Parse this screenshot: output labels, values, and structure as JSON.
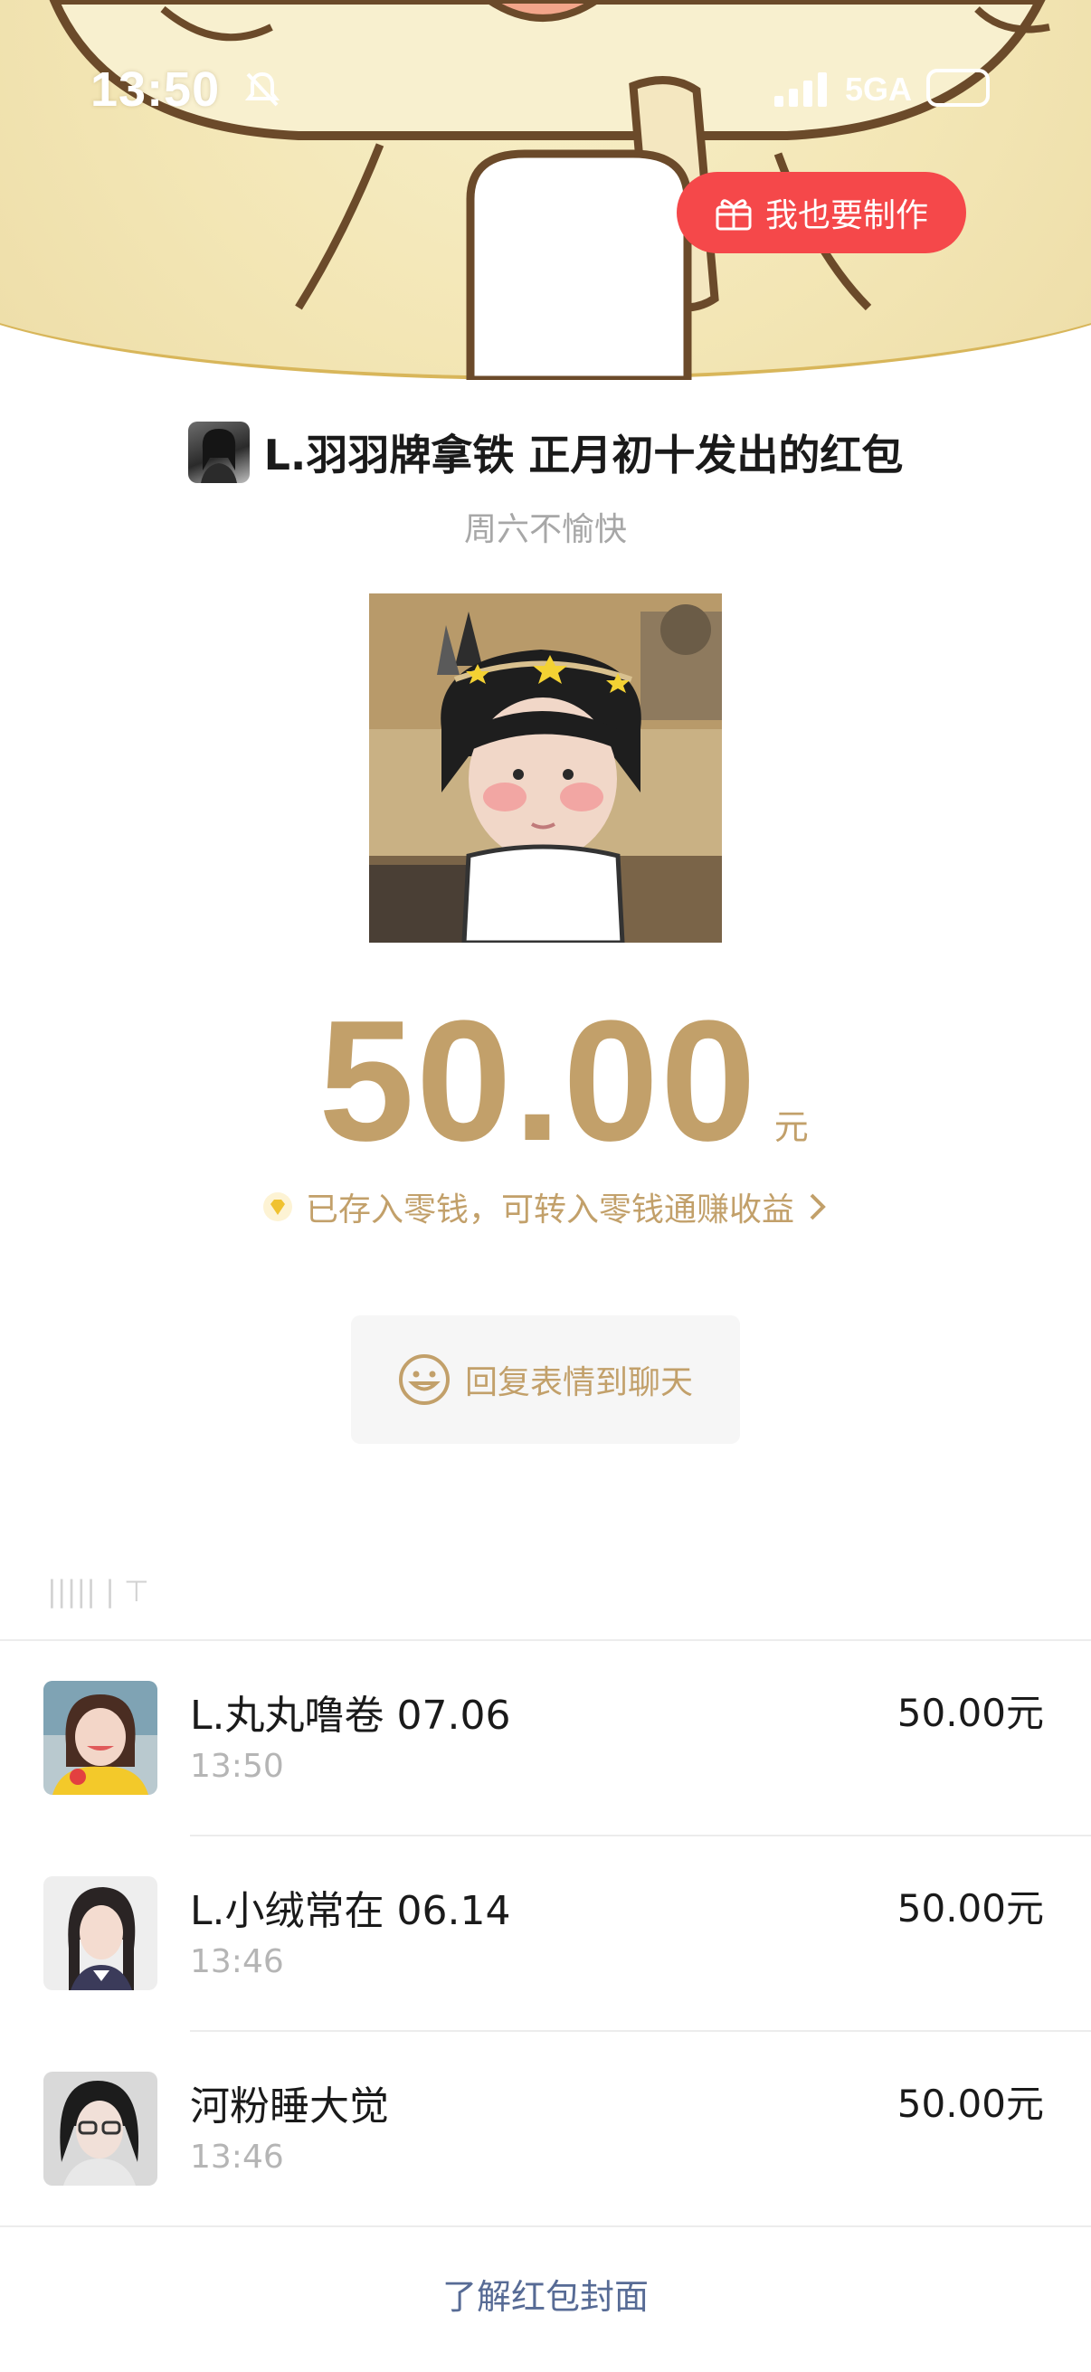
{
  "status_bar": {
    "time": "13:50",
    "network": "5GA",
    "icons": [
      "bell-mute-icon",
      "signal-icon",
      "battery-icon"
    ]
  },
  "cover": {
    "make_button_label": "我也要制作",
    "make_button_icon": "gift-icon"
  },
  "packet": {
    "sender_title": "L.羽羽牌拿铁 正月初十发出的红包",
    "greeting": "周六不愉快",
    "amount": "50.00",
    "amount_unit": "元",
    "saved_text": "已存入零钱，可转入零钱通赚收益",
    "reply_label": "回复表情到聊天",
    "count_label": "||||| | ⊤"
  },
  "receivers": [
    {
      "name": "L.丸丸噜卷 07.06",
      "time": "13:50",
      "amount": "50.00元"
    },
    {
      "name": "L.小绒常在 06.14",
      "time": "13:46",
      "amount": "50.00元"
    },
    {
      "name": "河粉睡大觉",
      "time": "13:46",
      "amount": "50.00元"
    }
  ],
  "footer": {
    "link_label": "了解红包封面"
  },
  "colors": {
    "gold": "#c2a06a",
    "red_button": "#f5484a",
    "link_blue": "#576b95"
  }
}
